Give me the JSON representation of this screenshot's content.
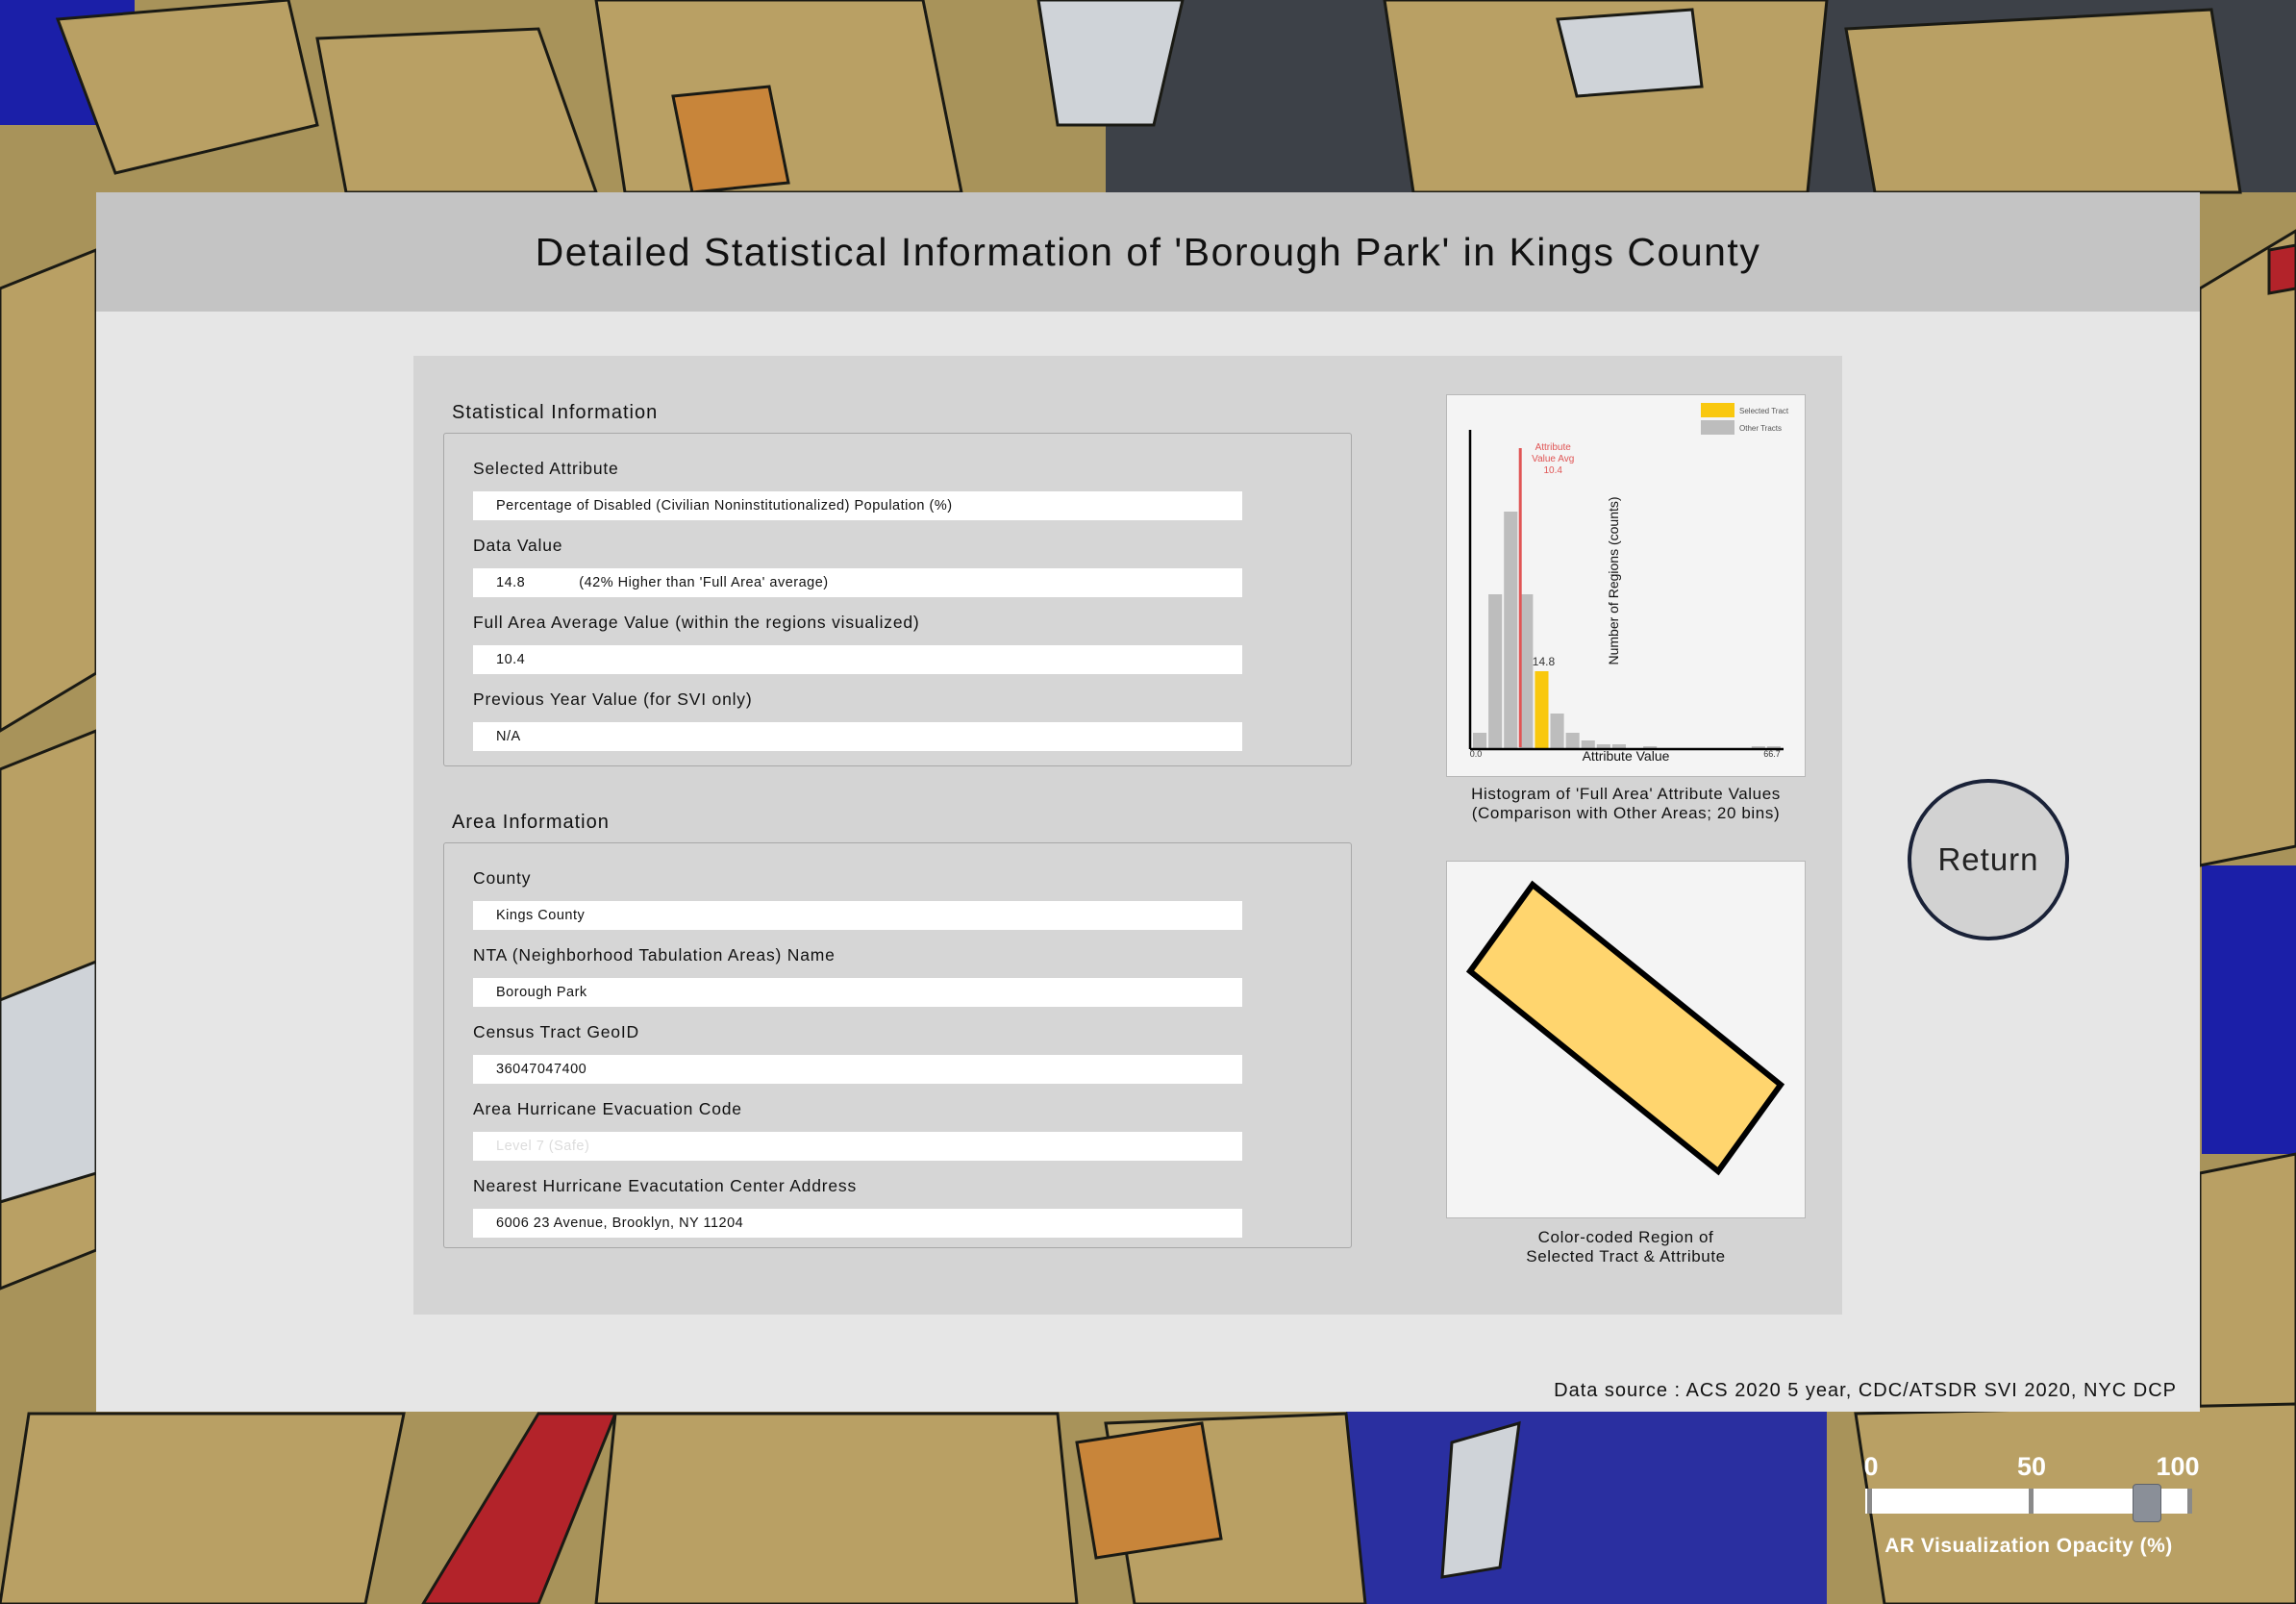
{
  "header": {
    "title": "Detailed Statistical Information of 'Borough Park' in Kings County"
  },
  "statistical_info": {
    "section_label": "Statistical Information",
    "selected_attribute": {
      "label": "Selected Attribute",
      "value": "Percentage of Disabled (Civilian Noninstitutionalized) Population (%)"
    },
    "data_value": {
      "label": "Data Value",
      "value": "14.8",
      "comparison": "(42% Higher than 'Full Area' average)"
    },
    "full_area_average": {
      "label": "Full Area Average Value (within the regions visualized)",
      "value": "10.4"
    },
    "previous_year": {
      "label": "Previous Year Value (for SVI only)",
      "value": "N/A"
    }
  },
  "area_info": {
    "section_label": "Area Information",
    "county": {
      "label": "County",
      "value": "Kings County"
    },
    "nta_name": {
      "label": "NTA (Neighborhood Tabulation Areas) Name",
      "value": "Borough Park"
    },
    "census_tract": {
      "label": "Census Tract GeoID",
      "value": "36047047400"
    },
    "hurricane_code": {
      "label": "Area Hurricane Evacuation Code",
      "value": "Level 7 (Safe)"
    },
    "evac_center": {
      "label": "Nearest Hurricane Evacutation Center Address",
      "value": "6006 23 Avenue, Brooklyn, NY 11204"
    }
  },
  "histogram": {
    "caption_line1": "Histogram of 'Full Area' Attribute Values",
    "caption_line2": "(Comparison with Other Areas; 20 bins)",
    "legend_selected": "Selected Tract",
    "legend_other": "Other Tracts",
    "avg_label_line1": "Attribute",
    "avg_label_line2": "Value Avg",
    "avg_label_line3": "10.4",
    "selected_label": "14.8",
    "colors": {
      "selected": "#f9c80e",
      "other": "#bdbdbd",
      "avg_line": "#e05555"
    }
  },
  "chart_data": {
    "type": "bar",
    "xlabel": "Attribute Value",
    "ylabel": "Number of Regions (counts)",
    "xlim": [
      0.0,
      66.7
    ],
    "x_tick_labels": [
      "0.0",
      "66.7"
    ],
    "values": [
      8,
      80,
      123,
      80,
      40,
      18,
      8,
      4,
      2,
      2,
      0,
      1,
      0,
      0,
      0,
      0,
      0,
      0,
      1,
      1
    ],
    "selected_bin": 4,
    "selected_value": 14.8,
    "average_value": 10.4
  },
  "region": {
    "caption_line1": "Color-coded Region of",
    "caption_line2": "Selected Tract & Attribute",
    "fill_color": "#ffd56e"
  },
  "footer": {
    "data_source": "Data source : ACS 2020 5 year, CDC/ATSDR SVI 2020, NYC DCP"
  },
  "return_button": {
    "label": "Return"
  },
  "opacity_slider": {
    "tick_labels": [
      "0",
      "50",
      "100"
    ],
    "caption": "AR Visualization Opacity (%)",
    "value_percent": 87
  }
}
